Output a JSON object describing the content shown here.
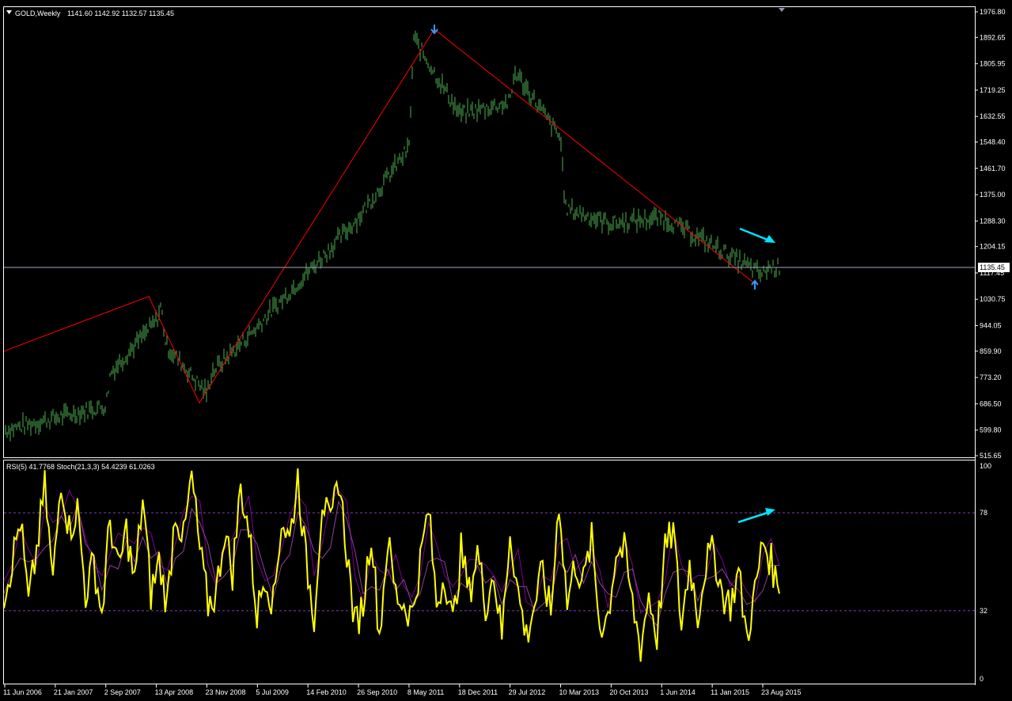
{
  "chart_data": [
    {
      "type": "bar",
      "title": "GOLD,Weekly",
      "ohlc_header": "1141.60 1142.92 1132.57 1135.45",
      "series_color": "#4caf50",
      "ylim": [
        515.65,
        1976.8
      ],
      "y_ticks": [
        "1976.80",
        "1892.65",
        "1805.95",
        "1719.25",
        "1632.55",
        "1548.40",
        "1461.70",
        "1375.00",
        "1288.30",
        "1204.15",
        "1117.45",
        "1030.75",
        "944.05",
        "859.90",
        "773.20",
        "686.50",
        "599.80",
        "515.65"
      ],
      "current_price": "1135.45",
      "price_line_color": "#a0a8c0",
      "x_ticks": [
        "11 Jun 2006",
        "21 Jan 2007",
        "2 Sep 2007",
        "13 Apr 2008",
        "23 Nov 2008",
        "5 Jul 2009",
        "14 Feb 2010",
        "26 Sep 2010",
        "8 May 2011",
        "18 Dec 2011",
        "29 Jul 2012",
        "10 Mar 2013",
        "20 Oct 2013",
        "1 Jun 2014",
        "11 Jan 2015",
        "23 Aug 2015"
      ],
      "price_path": [
        [
          "11 Jun 2006",
          600
        ],
        [
          "21 Jan 2007",
          640
        ],
        [
          "2 Sep 2007",
          680
        ],
        [
          "29 Oct 2007",
          790
        ],
        [
          "13 Apr 2008",
          960
        ],
        [
          "16 Mar 2008",
          1010
        ],
        [
          "13 Apr 2008",
          880
        ],
        [
          "23 Nov 2008",
          720
        ],
        [
          "23 Nov 2008",
          790
        ],
        [
          "5 Jul 2009",
          940
        ],
        [
          "5 Jul 2009",
          960
        ],
        [
          "14 Feb 2010",
          1120
        ],
        [
          "26 Sep 2010",
          1300
        ],
        [
          "8 May 2011",
          1530
        ],
        [
          "8 May 2011",
          1890
        ],
        [
          "18 Dec 2011",
          1640
        ],
        [
          "29 Jul 2012",
          1680
        ],
        [
          "29 Jul 2012",
          1780
        ],
        [
          "10 Mar 2013",
          1560
        ],
        [
          "10 Mar 2013",
          1330
        ],
        [
          "20 Oct 2013",
          1280
        ],
        [
          "1 Jun 2014",
          1300
        ],
        [
          "11 Jan 2015",
          1210
        ],
        [
          "23 Aug 2015",
          1110
        ],
        [
          "23 Aug 2015",
          1135
        ]
      ],
      "zigzag": {
        "color": "#ff0000",
        "points": [
          [
            "11 Jun 2006",
            860
          ],
          [
            "16 Mar 2008",
            1040
          ],
          [
            "23 Nov 2008",
            690
          ],
          [
            "8 May 2011",
            1920
          ],
          [
            "23 Aug 2015",
            1080
          ]
        ]
      },
      "arrows": [
        {
          "name": "top-marker",
          "color": "#3399ff",
          "direction": "down",
          "at": [
            "8 May 2011",
            1920
          ]
        },
        {
          "name": "bottom-marker",
          "color": "#3399ff",
          "direction": "up",
          "at": [
            "23 Aug 2015",
            1080
          ]
        },
        {
          "name": "price-trend-arrow",
          "color": "#00e5ff",
          "direction": "down"
        }
      ]
    },
    {
      "type": "line",
      "header": "RSI(5) 41.7768  Stoch(21,3,3) 54.4239 61.0263",
      "ylim": [
        0,
        100
      ],
      "y_ticks": [
        "100",
        "78",
        "32",
        "0"
      ],
      "levels": [
        78,
        32
      ],
      "level_color": "#7f3fbf",
      "series": [
        {
          "name": "RSI(5)",
          "color": "#ffff00",
          "values": [
            40,
            55,
            75,
            35,
            60,
            90,
            45,
            95,
            70,
            80,
            40,
            55,
            30,
            75,
            50,
            70,
            45,
            85,
            40,
            55,
            35,
            80,
            65,
            95,
            60,
            35,
            40,
            70,
            50,
            90,
            70,
            30,
            50,
            35,
            75,
            65,
            95,
            55,
            30,
            85,
            70,
            95,
            60,
            25,
            35,
            70,
            20,
            65,
            40,
            35,
            30,
            55,
            80,
            35,
            50,
            25,
            60,
            40,
            60,
            35,
            50,
            20,
            70,
            40,
            20,
            35,
            50,
            30,
            85,
            35,
            55,
            45,
            65,
            25,
            30,
            60,
            60,
            35,
            15,
            40,
            20,
            60,
            70,
            25,
            55,
            30,
            55,
            60,
            40,
            35,
            50,
            20,
            40,
            65,
            55,
            40
          ]
        },
        {
          "name": "Stoch main",
          "color": "#8000a0"
        },
        {
          "name": "Stoch signal",
          "color": "#9040a0"
        }
      ],
      "x_ticks": [
        "11 Jun 2006",
        "21 Jan 2007",
        "2 Sep 2007",
        "13 Apr 2008",
        "23 Nov 2008",
        "5 Jul 2009",
        "14 Feb 2010",
        "26 Sep 2010",
        "8 May 2011",
        "18 Dec 2011",
        "29 Jul 2012",
        "10 Mar 2013",
        "20 Oct 2013",
        "1 Jun 2014",
        "11 Jan 2015",
        "23 Aug 2015"
      ],
      "arrows": [
        {
          "name": "rsi-trend-arrow",
          "color": "#00e5ff",
          "direction": "up"
        }
      ]
    }
  ]
}
